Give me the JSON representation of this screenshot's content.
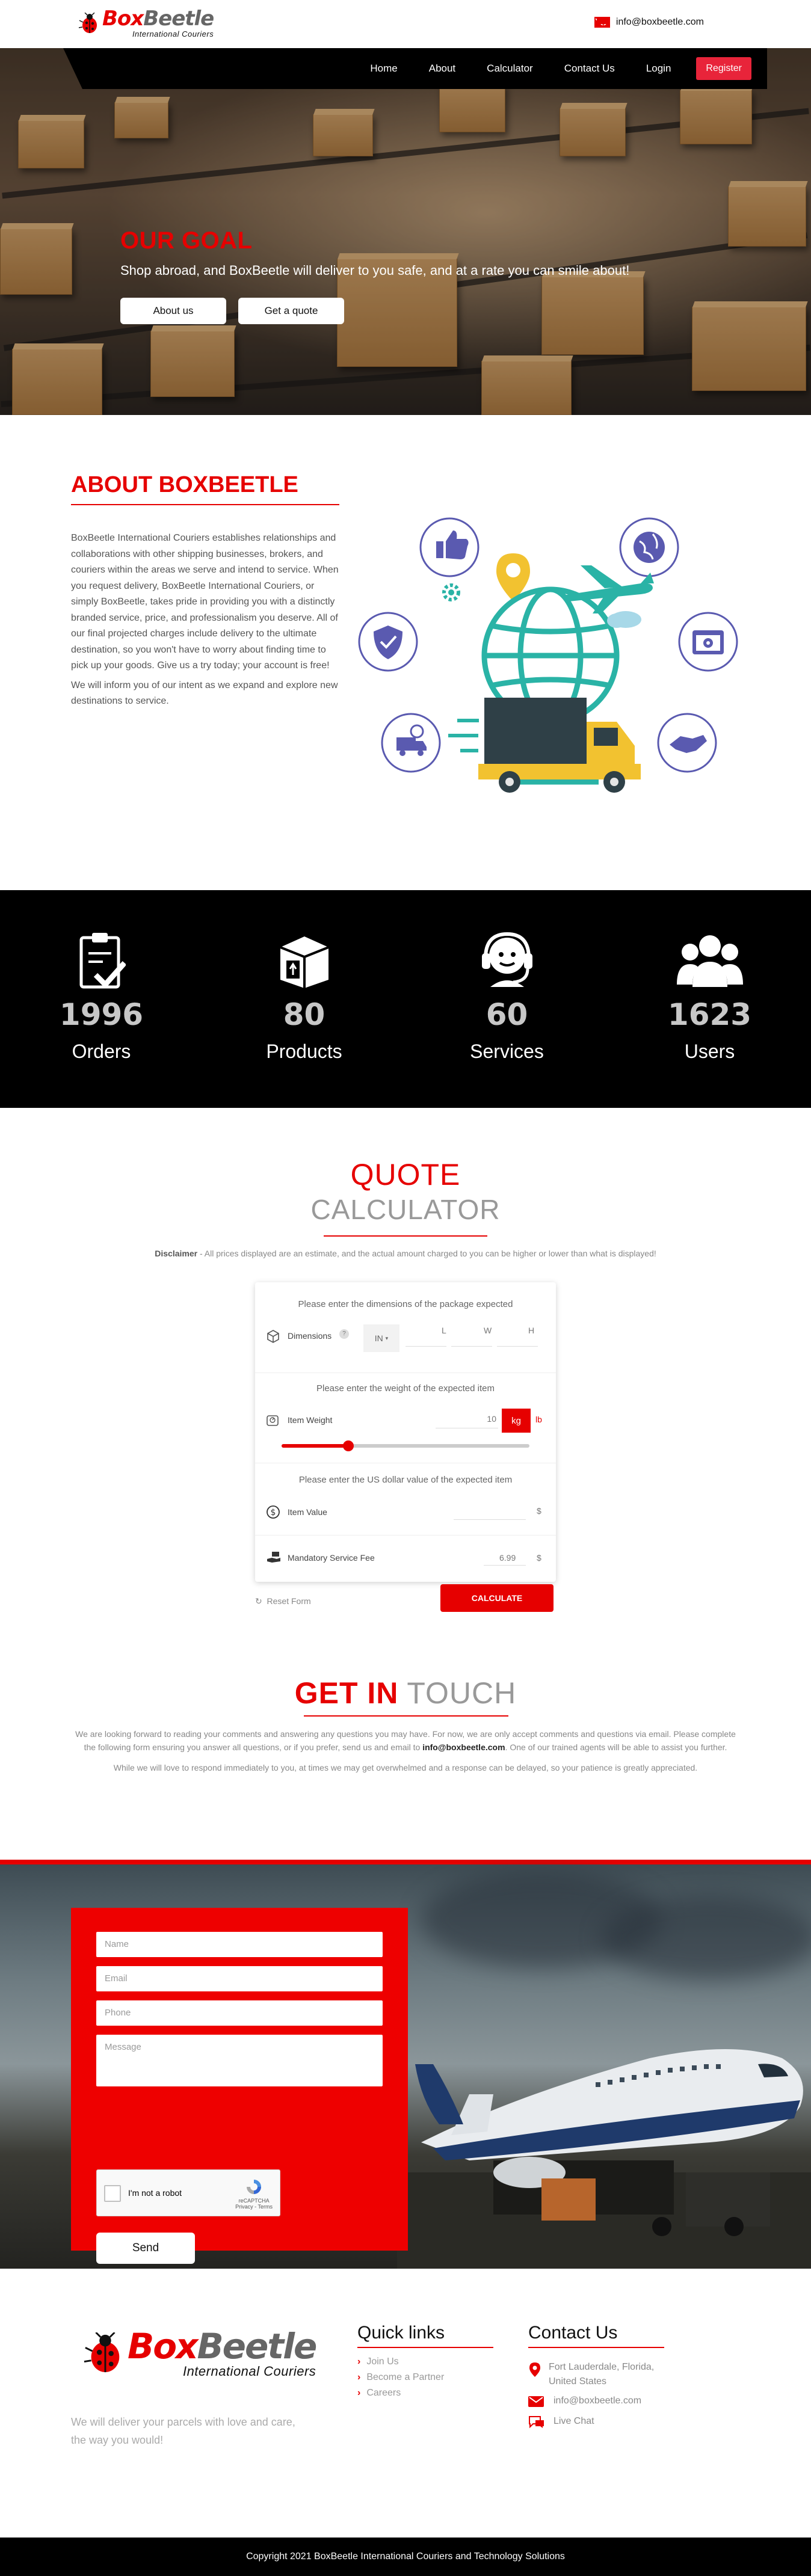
{
  "brand": {
    "name_part1": "Box",
    "name_part2": "Beetle",
    "sub": "International Couriers"
  },
  "topbar": {
    "email": "info@boxbeetle.com"
  },
  "nav": {
    "items": [
      "Home",
      "About",
      "Calculator",
      "Contact Us",
      "Login"
    ],
    "register": "Register"
  },
  "hero": {
    "title": "OUR GOAL",
    "text": "Shop abroad, and BoxBeetle will deliver to you safe, and at a rate you can smile about!",
    "buttons": [
      "About us",
      "Get a quote"
    ]
  },
  "about": {
    "title": "ABOUT BOXBEETLE",
    "paragraphs": [
      "BoxBeetle International Couriers establishes relationships and collaborations with other shipping businesses, brokers, and couriers within the areas we serve and intend to service. When you request delivery, BoxBeetle International Couriers, or simply BoxBeetle, takes pride in providing you with a distinctly branded service, price, and professionalism you deserve. All of our final projected charges include delivery to the ultimate destination, so you won't have to worry about finding time to pick up your goods. Give us a try today; your account is free!",
      "We will inform you of our intent as we expand and explore new destinations to service."
    ]
  },
  "stats": [
    {
      "icon": "clipboard-check-icon",
      "value": "1996",
      "label": "Orders"
    },
    {
      "icon": "package-box-icon",
      "value": "80",
      "label": "Products"
    },
    {
      "icon": "headset-support-icon",
      "value": "60",
      "label": "Services"
    },
    {
      "icon": "users-group-icon",
      "value": "1623",
      "label": "Users"
    }
  ],
  "quote": {
    "title1": "QUOTE",
    "title2": "CALCULATOR",
    "disclaimer_label": "Disclaimer",
    "disclaimer_text": " - All prices displayed are an estimate, and the actual amount charged to you can be higher or lower than what is displayed!",
    "dims_caption": "Please enter the dimensions of the package expected",
    "dims_label": "Dimensions",
    "dims_unit": "IN",
    "dims_l": "L",
    "dims_w": "W",
    "dims_h": "H",
    "weight_caption": "Please enter the weight of the expected item",
    "weight_label": "Item Weight",
    "weight_value": "10",
    "weight_unit_active": "kg",
    "weight_unit_alt": "lb",
    "weight_slider_fraction": 0.27,
    "value_caption": "Please enter the US dollar value of the expected item",
    "value_label": "Item Value",
    "value_currency": "$",
    "fee_label": "Mandatory Service Fee",
    "fee_value": "6.99",
    "fee_currency": "$",
    "reset": "Reset Form",
    "calculate": "CALCULATE"
  },
  "touch": {
    "title_red": "GET IN",
    "title_grey": "TOUCH",
    "p1_before": "We are looking forward to reading your comments and answering any questions you may have. For now, we are only accept comments and questions via email. Please complete the following form ensuring you answer all questions, or if you prefer, send us and email to ",
    "p1_email": "info@boxbeetle.com",
    "p1_after": ". One of our trained agents will be able to assist you further.",
    "p2": "While we will love to respond immediately to you, at times we may get overwhelmed and a response can be delayed, so your patience is greatly appreciated."
  },
  "form": {
    "name_placeholder": "Name",
    "email_placeholder": "Email",
    "phone_placeholder": "Phone",
    "message_placeholder": "Message",
    "captcha_label": "I'm not a robot",
    "captcha_brand": "reCAPTCHA",
    "captcha_links": "Privacy - Terms",
    "send": "Send"
  },
  "footer": {
    "tagline_line1": "We will deliver your parcels with love and care,",
    "tagline_line2": "the way you would!",
    "quicklinks_title": "Quick links",
    "quicklinks": [
      "Join Us",
      "Become a Partner",
      "Careers"
    ],
    "contact_title": "Contact Us",
    "address_line1": "Fort Lauderdale, Florida,",
    "address_line2": "United States",
    "email": "info@boxbeetle.com",
    "chat": "Live Chat",
    "copyright": "Copyright 2021 BoxBeetle International Couriers and Technology Solutions"
  },
  "colors": {
    "accent": "#e60000",
    "dark": "#000000",
    "muted": "#999999"
  }
}
